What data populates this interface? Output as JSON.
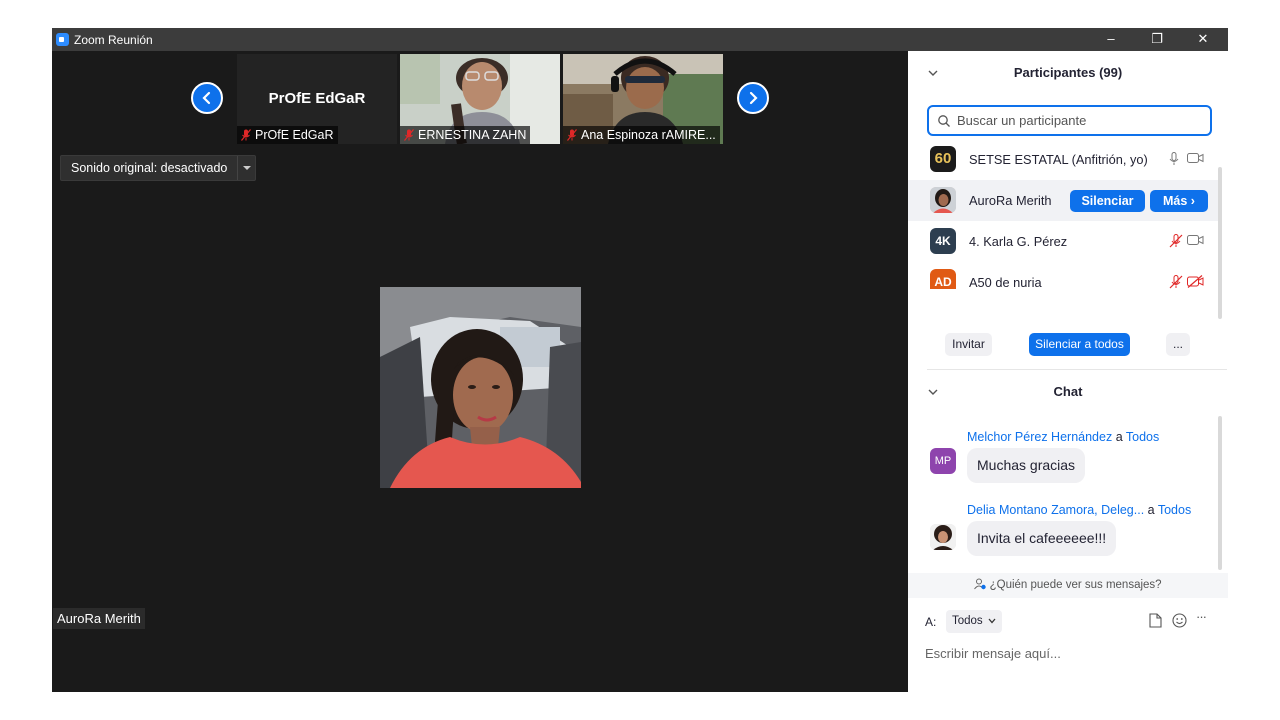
{
  "window": {
    "title": "Zoom Reunión",
    "minimize": "–",
    "restore": "❐",
    "close": "✕"
  },
  "thumbnails": [
    {
      "big_name": "PrOfE EdGaR",
      "label": "PrOfE EdGaR"
    },
    {
      "big_name": "",
      "label": "ERNESTINA ZAHN"
    },
    {
      "big_name": "",
      "label": "Ana Espinoza rAMIRE..."
    }
  ],
  "sound": {
    "label": "Sonido original: desactivado"
  },
  "speaker": {
    "name": "AuroRa Merith"
  },
  "participants": {
    "header": "Participantes (99)",
    "search_placeholder": "Buscar un participante",
    "rows": [
      {
        "avatar": "60",
        "name": "SETSE ESTATAL (Anfitrión, yo)"
      },
      {
        "avatar": "",
        "name": "AuroRa Merith",
        "mute_label": "Silenciar",
        "more_label": "Más ›"
      },
      {
        "avatar": "4K",
        "name": "4. Karla G. Pérez"
      },
      {
        "avatar": "AD",
        "name": "A50 de nuria"
      }
    ],
    "invite_label": "Invitar",
    "mute_all_label": "Silenciar a todos",
    "more_label": "..."
  },
  "chat": {
    "header": "Chat",
    "messages": [
      {
        "avatar": "MP",
        "from": "Melchor Pérez Hernández",
        "connector": "a",
        "to": "Todos",
        "text": "Muchas gracias"
      },
      {
        "avatar": "",
        "from": "Delia Montano Zamora, Deleg...",
        "connector": "a",
        "to": "Todos",
        "text": "Invita el cafeeeeee!!!"
      }
    ],
    "who_can_see": "¿Quién puede ver sus mensajes?",
    "to_label": "A:",
    "to_value": "Todos",
    "input_placeholder": "Escribir mensaje aquí...",
    "more_icon": "···"
  },
  "colors": {
    "accent": "#0e71eb",
    "mic_off": "#e02828",
    "stage": "#1a1a1a"
  }
}
